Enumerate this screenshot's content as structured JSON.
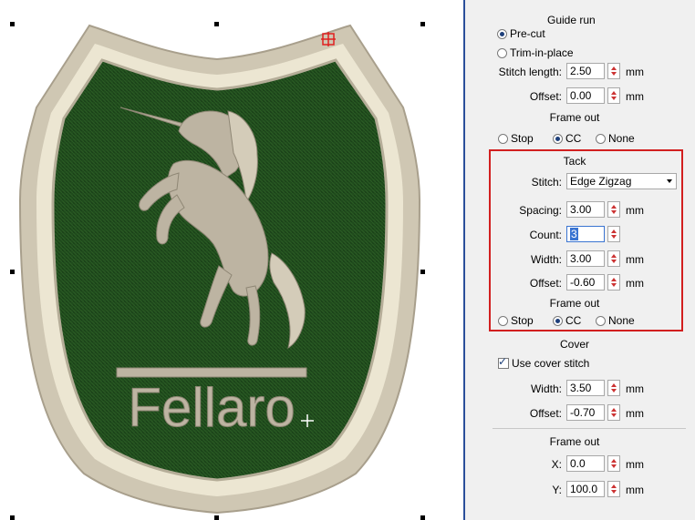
{
  "badge": {
    "text": "Fellaro",
    "colors": {
      "green": "#1f4a1c",
      "border": "#cfc7b3",
      "inner": "#ece6d2"
    }
  },
  "guide_run": {
    "title": "Guide run",
    "precut": "Pre-cut",
    "trim": "Trim-in-place",
    "stitch_length_label": "Stitch length:",
    "stitch_length": "2.50",
    "offset_label": "Offset:",
    "offset": "0.00",
    "unit": "mm",
    "frame_out_title": "Frame out",
    "stop": "Stop",
    "cc": "CC",
    "none": "None"
  },
  "tack": {
    "title": "Tack",
    "stitch_label": "Stitch:",
    "stitch": "Edge Zigzag",
    "spacing_label": "Spacing:",
    "spacing": "3.00",
    "count_label": "Count:",
    "count": "3",
    "width_label": "Width:",
    "width": "3.00",
    "offset_label": "Offset:",
    "offset": "-0.60",
    "unit": "mm",
    "frame_out_title": "Frame out",
    "stop": "Stop",
    "cc": "CC",
    "none": "None"
  },
  "cover": {
    "title": "Cover",
    "use_cover": "Use cover stitch",
    "width_label": "Width:",
    "width": "3.50",
    "offset_label": "Offset:",
    "offset": "-0.70",
    "unit": "mm"
  },
  "frame_out": {
    "title": "Frame out",
    "x_label": "X:",
    "x": "0.0",
    "y_label": "Y:",
    "y": "100.0",
    "unit": "mm"
  }
}
